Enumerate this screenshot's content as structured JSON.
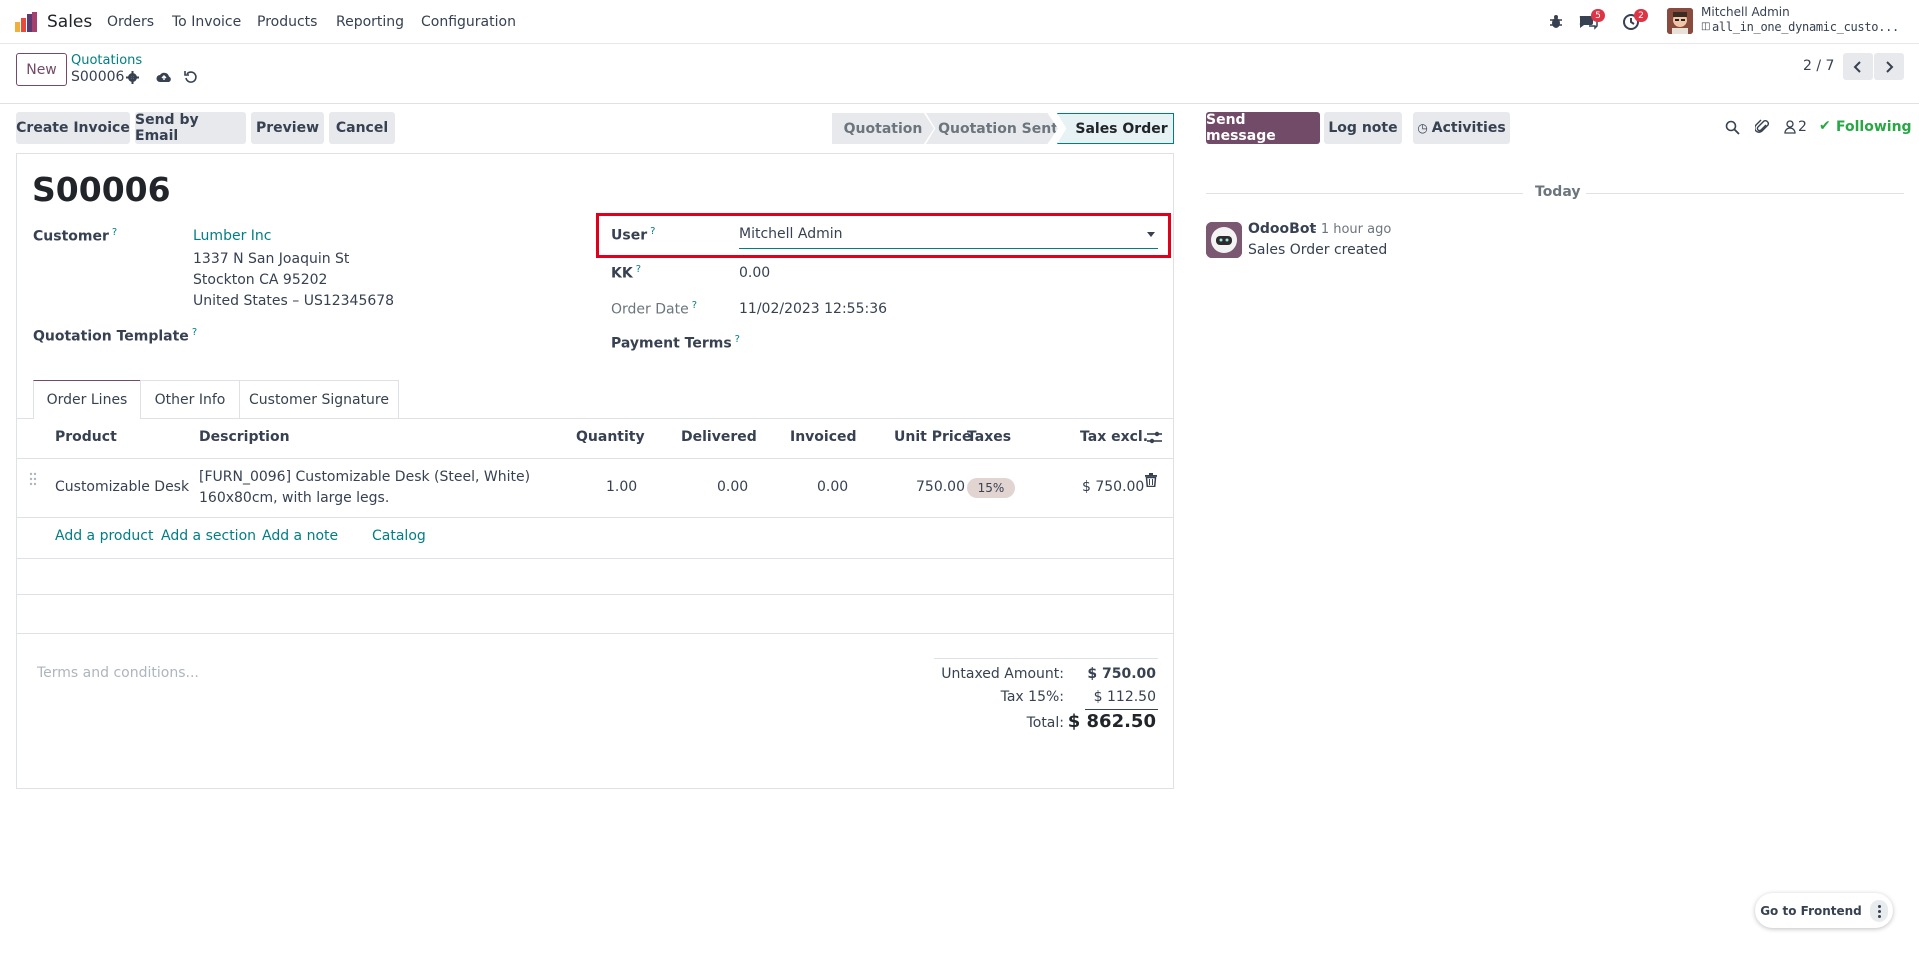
{
  "navbar": {
    "app_name": "Sales",
    "menu": [
      "Orders",
      "To Invoice",
      "Products",
      "Reporting",
      "Configuration"
    ],
    "messages_badge": "5",
    "activities_badge": "2",
    "user_name": "Mitchell Admin",
    "database": "all_in_one_dynamic_custo..."
  },
  "control": {
    "new_label": "New",
    "breadcrumb_parent": "Quotations",
    "record_name": "S00006",
    "pager": "2 / 7"
  },
  "actions": {
    "create_invoice": "Create Invoice",
    "send_by_email": "Send by Email",
    "preview": "Preview",
    "cancel": "Cancel"
  },
  "stages": [
    "Quotation",
    "Quotation Sent",
    "Sales Order"
  ],
  "form": {
    "title": "S00006",
    "customer_label": "Customer",
    "customer_name": "Lumber Inc",
    "address_1": "1337 N San Joaquin St",
    "address_2": "Stockton CA 95202",
    "address_3": "United States – US12345678",
    "quotation_template_label": "Quotation Template",
    "user_label": "User",
    "user_value": "Mitchell Admin",
    "kk_label": "KK",
    "kk_value": "0.00",
    "order_date_label": "Order Date",
    "order_date_value": "11/02/2023 12:55:36",
    "payment_terms_label": "Payment Terms",
    "help_mark": "?"
  },
  "tabs": [
    "Order Lines",
    "Other Info",
    "Customer Signature"
  ],
  "table": {
    "headers": [
      "Product",
      "Description",
      "Quantity",
      "Delivered",
      "Invoiced",
      "Unit Price",
      "Taxes",
      "Tax excl."
    ],
    "row": {
      "product": "Customizable Desk",
      "description_1": "[FURN_0096] Customizable Desk (Steel, White)",
      "description_2": "160x80cm, with large legs.",
      "quantity": "1.00",
      "delivered": "0.00",
      "invoiced": "0.00",
      "unit_price": "750.00",
      "tax": "15%",
      "subtotal": "$ 750.00"
    },
    "add_product": "Add a product",
    "add_section": "Add a section",
    "add_note": "Add a note",
    "catalog": "Catalog"
  },
  "totals": {
    "terms_placeholder": "Terms and conditions...",
    "untaxed_label": "Untaxed Amount:",
    "untaxed_value": "$ 750.00",
    "tax_label": "Tax 15%:",
    "tax_value": "$ 112.50",
    "total_label": "Total:",
    "total_value": "$ 862.50"
  },
  "chatter": {
    "send_message": "Send message",
    "log_note": "Log note",
    "activities": "Activities",
    "followers_count": "2",
    "following": "Following",
    "date_separator": "Today",
    "author": "OdooBot",
    "time": "- 1 hour ago",
    "body": "Sales Order created"
  },
  "frontend": {
    "label": "Go to Frontend"
  },
  "colors": {
    "brand": "#714b67",
    "link": "#017e84",
    "highlight": "#e0001b",
    "success": "#28a745",
    "danger": "#dc3545"
  }
}
